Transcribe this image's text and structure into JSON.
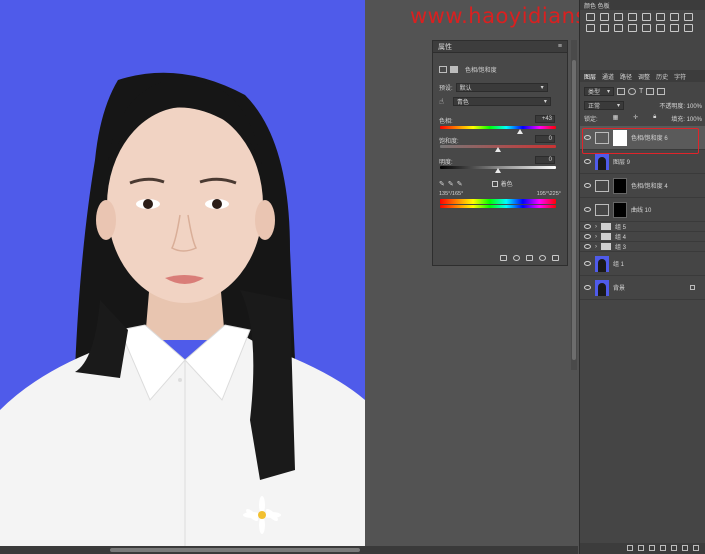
{
  "watermark": "www.haoyidianshell.com",
  "properties": {
    "title": "属性",
    "adjustment_name": "色相/饱和度",
    "preset_label": "预设:",
    "preset_value": "默认",
    "channel_value": "青色",
    "hue_label": "色相:",
    "hue_value": "+43",
    "saturation_label": "饱和度:",
    "saturation_value": "0",
    "lightness_label": "明度:",
    "lightness_value": "0",
    "colorize_label": "着色",
    "range_left": "135°/165°",
    "range_right": "195°\\225°"
  },
  "dock": {
    "adjustments_header": "颜色  色板",
    "layer_tabs": [
      "图层",
      "通道",
      "路径",
      "调整",
      "历史",
      "字符"
    ],
    "filter_label": "类型",
    "blend_mode": "正常",
    "opacity_label": "不透明度: 100%",
    "lock_label": "锁定:",
    "fill_label": "填充: 100%",
    "layers": [
      {
        "name": "色相/饱和度 6",
        "kind": "adjustment-white",
        "selected": true
      },
      {
        "name": "图层 9",
        "kind": "photo"
      },
      {
        "name": "色相/饱和度 4",
        "kind": "adjustment-black"
      },
      {
        "name": "曲线 10",
        "kind": "adjustment-black"
      },
      {
        "name": "组 5",
        "kind": "folder"
      },
      {
        "name": "组 4",
        "kind": "folder"
      },
      {
        "name": "组 3",
        "kind": "folder"
      },
      {
        "name": "组 1",
        "kind": "photo"
      },
      {
        "name": "背景",
        "kind": "photo-locked"
      }
    ]
  }
}
